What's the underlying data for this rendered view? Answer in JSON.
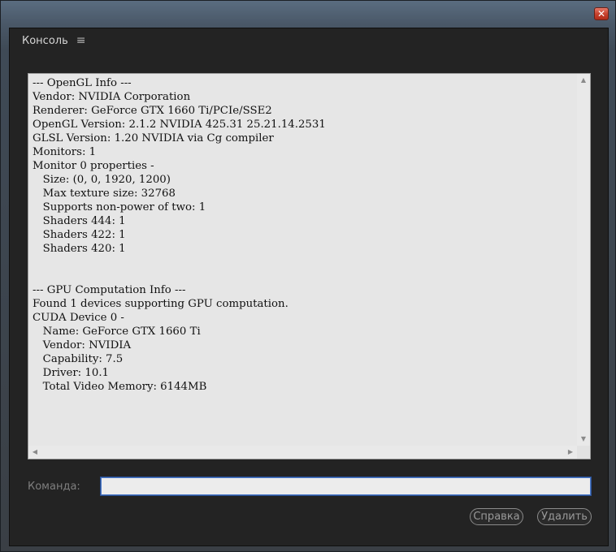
{
  "window": {
    "close_glyph": "✕"
  },
  "panel": {
    "title": "Консоль",
    "menu_glyph": "≡"
  },
  "console": {
    "text": "--- OpenGL Info ---\nVendor: NVIDIA Corporation\nRenderer: GeForce GTX 1660 Ti/PCIe/SSE2\nOpenGL Version: 2.1.2 NVIDIA 425.31 25.21.14.2531\nGLSL Version: 1.20 NVIDIA via Cg compiler\nMonitors: 1\nMonitor 0 properties -\n   Size: (0, 0, 1920, 1200)\n   Max texture size: 32768\n   Supports non-power of two: 1\n   Shaders 444: 1\n   Shaders 422: 1\n   Shaders 420: 1\n\n\n--- GPU Computation Info ---\nFound 1 devices supporting GPU computation.\nCUDA Device 0 -\n   Name: GeForce GTX 1660 Ti\n   Vendor: NVIDIA\n   Capability: 7.5\n   Driver: 10.1\n   Total Video Memory: 6144MB",
    "scroll_up_glyph": "▲",
    "scroll_down_glyph": "▼",
    "scroll_left_glyph": "◀",
    "scroll_right_glyph": "▶"
  },
  "command": {
    "label": "Команда:",
    "value": "",
    "placeholder": ""
  },
  "buttons": {
    "help_label": "Справка",
    "delete_label": "Удалить"
  },
  "colors": {
    "close_red": "#c8432f",
    "input_focus_blue": "#4a78c8",
    "panel_bg": "#232323",
    "console_bg": "#e6e6e6"
  }
}
